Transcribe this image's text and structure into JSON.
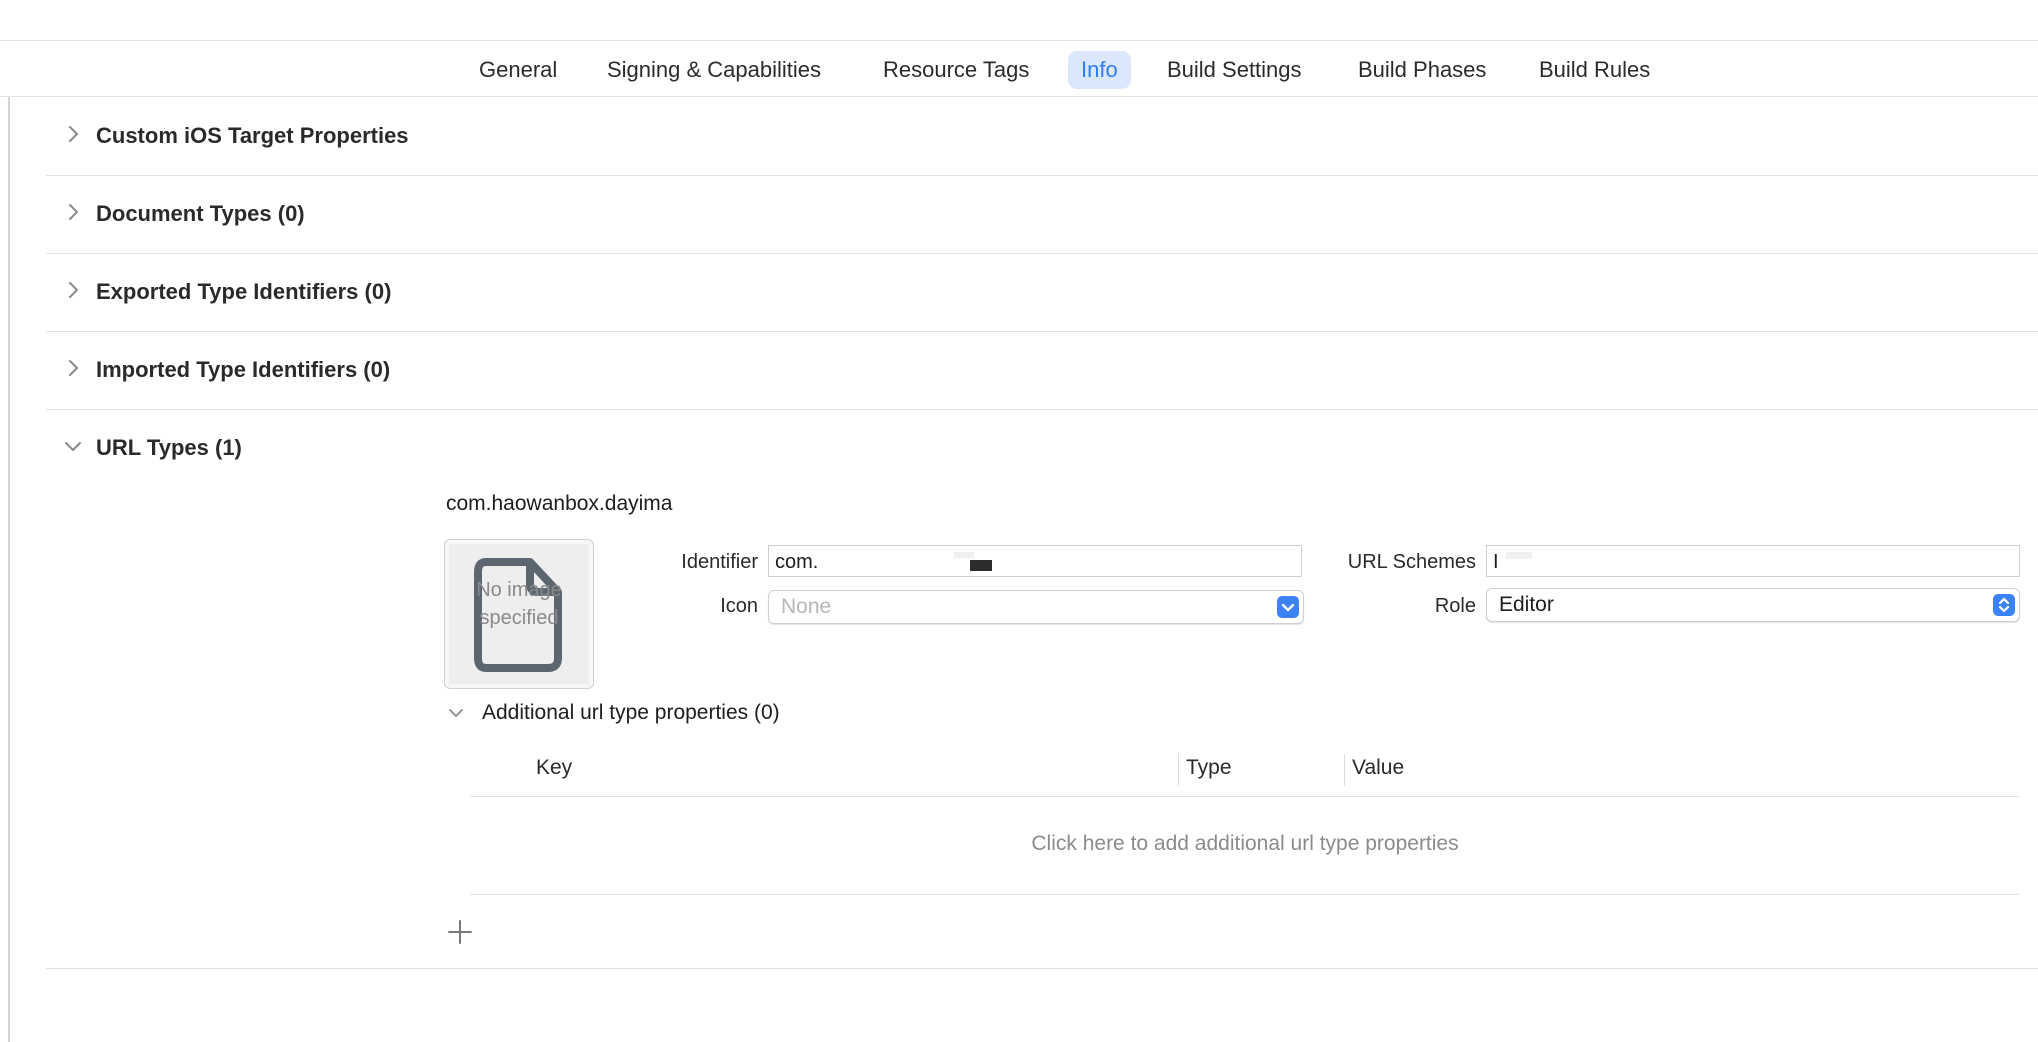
{
  "tabs": [
    {
      "label": "General",
      "active": false
    },
    {
      "label": "Signing & Capabilities",
      "active": false
    },
    {
      "label": "Resource Tags",
      "active": false
    },
    {
      "label": "Info",
      "active": true
    },
    {
      "label": "Build Settings",
      "active": false
    },
    {
      "label": "Build Phases",
      "active": false
    },
    {
      "label": "Build Rules",
      "active": false
    }
  ],
  "sections": [
    {
      "title": "Custom iOS Target Properties",
      "expanded": false
    },
    {
      "title": "Document Types (0)",
      "expanded": false
    },
    {
      "title": "Exported Type Identifiers (0)",
      "expanded": false
    },
    {
      "title": "Imported Type Identifiers (0)",
      "expanded": false
    },
    {
      "title": "URL Types (1)",
      "expanded": true
    }
  ],
  "url_type": {
    "name": "com.haowanbox.dayima",
    "image_well_text": "No image specified",
    "identifier_label": "Identifier",
    "identifier_value": "com.",
    "icon_label": "Icon",
    "icon_placeholder": "None",
    "url_schemes_label": "URL Schemes",
    "url_schemes_value": "I",
    "role_label": "Role",
    "role_value": "Editor",
    "additional": {
      "title": "Additional url type properties (0)",
      "columns": [
        "Key",
        "Type",
        "Value"
      ],
      "empty_message": "Click here to add additional url type properties"
    }
  },
  "colors": {
    "accent": "#2f7cf6",
    "active_tab_bg": "#dbe8fb",
    "popup_button": "#3b82f6"
  }
}
